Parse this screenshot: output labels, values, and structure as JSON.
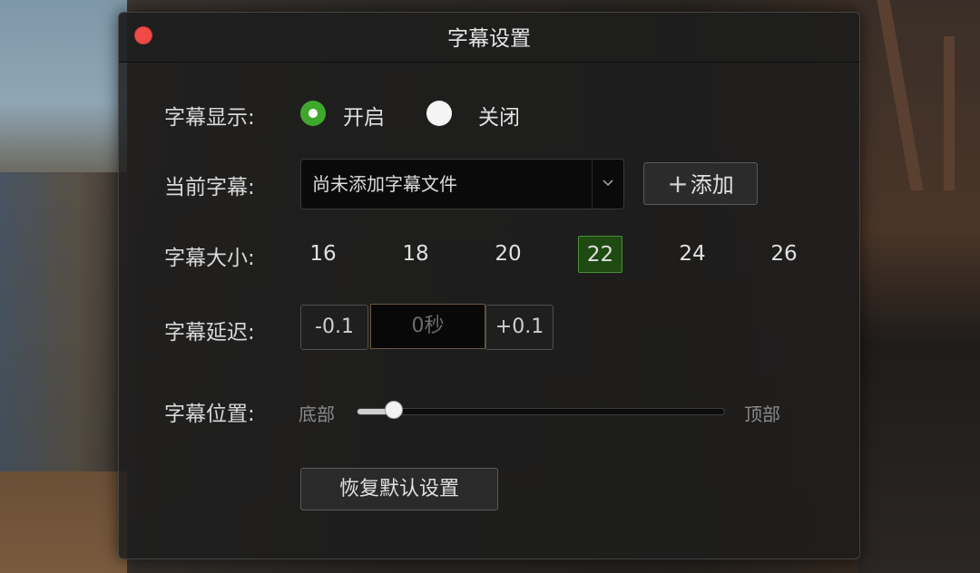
{
  "window": {
    "title": "字幕设置"
  },
  "display": {
    "label": "字幕显示:",
    "options": [
      "开启",
      "关闭"
    ],
    "selected": "开启"
  },
  "current": {
    "label": "当前字幕:",
    "value": "尚未添加字幕文件",
    "add_label": "添加"
  },
  "size": {
    "label": "字幕大小:",
    "options": [
      "16",
      "18",
      "20",
      "22",
      "24",
      "26"
    ],
    "selected": "22"
  },
  "delay": {
    "label": "字幕延迟:",
    "minus_label": "-0.1",
    "value": "0秒",
    "plus_label": "+0.1"
  },
  "position": {
    "label": "字幕位置:",
    "min_label": "底部",
    "max_label": "顶部",
    "value_fraction": 0.1
  },
  "reset_label": "恢复默认设置",
  "colors": {
    "accent_green": "#3fa82c",
    "selected_bg": "#1f4a12",
    "close_red": "#ef4a45"
  }
}
